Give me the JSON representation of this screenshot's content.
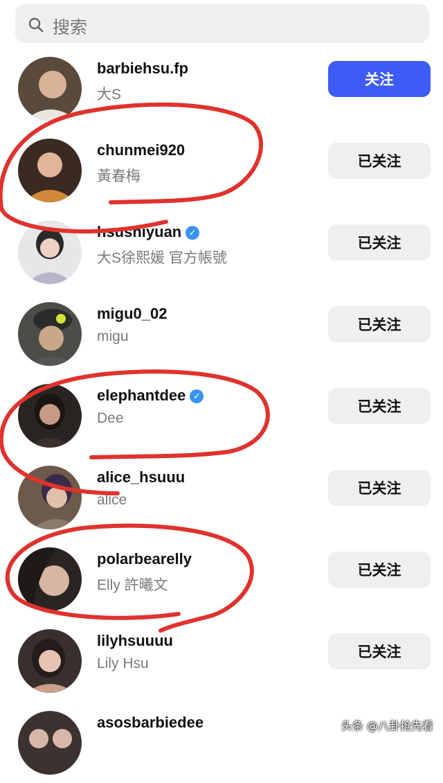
{
  "search": {
    "placeholder": "搜索",
    "icon": "search-icon"
  },
  "users": [
    {
      "username": "barbiehsu.fp",
      "display_name": "大S",
      "verified": false,
      "button": "关注",
      "following": false,
      "avatar_colors": [
        "#5a4a3c",
        "#d9b49a"
      ]
    },
    {
      "username": "chunmei920",
      "display_name": "黃春梅",
      "verified": false,
      "button": "已关注",
      "following": true,
      "avatar_colors": [
        "#3a2a22",
        "#d08a3a"
      ]
    },
    {
      "username": "hsushiyuan",
      "display_name": "大S徐熙媛 官方帳號",
      "verified": true,
      "button": "已关注",
      "following": true,
      "avatar_colors": [
        "#e7e7ea",
        "#2a2a2a"
      ]
    },
    {
      "username": "migu0_02",
      "display_name": "migu",
      "verified": false,
      "button": "已关注",
      "following": true,
      "avatar_colors": [
        "#4d4d48",
        "#c9a88a"
      ]
    },
    {
      "username": "elephantdee",
      "display_name": "Dee",
      "verified": true,
      "button": "已关注",
      "following": true,
      "avatar_colors": [
        "#2a2420",
        "#c69a84"
      ]
    },
    {
      "username": "alice_hsuuu",
      "display_name": "alice",
      "verified": false,
      "button": "已关注",
      "following": true,
      "avatar_colors": [
        "#6d5a4a",
        "#e0c0a8"
      ]
    },
    {
      "username": "polarbearelly",
      "display_name": "Elly 許曦文",
      "verified": false,
      "button": "已关注",
      "following": true,
      "avatar_colors": [
        "#2b2522",
        "#d8b6a4"
      ]
    },
    {
      "username": "lilyhsuuuu",
      "display_name": "Lily Hsu",
      "verified": false,
      "button": "已关注",
      "following": true,
      "avatar_colors": [
        "#3a2f2c",
        "#e6c3b2"
      ]
    },
    {
      "username": "asosbarbiedee",
      "display_name": "",
      "verified": false,
      "button": "",
      "following": true,
      "avatar_colors": [
        "#3c3330",
        "#d7b8a8"
      ]
    }
  ],
  "annotation_color": "#e0322e",
  "watermark": "头条 @八卦抢先看"
}
